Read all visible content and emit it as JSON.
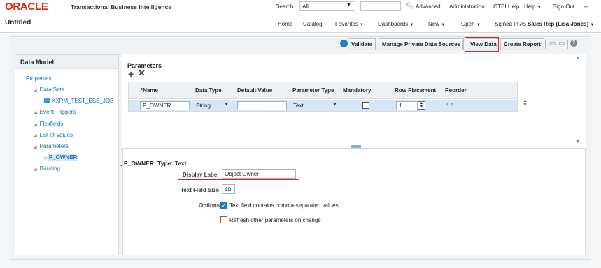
{
  "header": {
    "logo": "ORACLE",
    "product": "Transactional Business Intelligence",
    "search_label": "Search",
    "search_scope": "All",
    "advanced": "Advanced",
    "administration": "Administration",
    "otbi_help": "OTBI Help",
    "help": "Help",
    "sign_out": "Sign Out"
  },
  "subheader": {
    "title": "Untitled",
    "home": "Home",
    "catalog": "Catalog",
    "favorites": "Favorites",
    "dashboards": "Dashboards",
    "new": "New",
    "open": "Open",
    "signed_in_as": "Signed In As",
    "user": "Sales Rep (Lisa Jones)"
  },
  "toolbar": {
    "validate": "Validate",
    "manage_sources": "Manage Private Data Sources",
    "view_data": "View Data",
    "create_report": "Create Report"
  },
  "tree": {
    "header": "Data Model",
    "properties": "Properties",
    "data_sets": "Data Sets",
    "dataset_item": "XXRM_TEST_ESS_JOB",
    "event_triggers": "Event Triggers",
    "flexfields": "Flexfields",
    "list_of_values": "List of Values",
    "parameters": "Parameters",
    "param_item": "P_OWNER",
    "bursting": "Bursting"
  },
  "parameters": {
    "title": "Parameters",
    "columns": {
      "name": "*Name",
      "data_type": "Data Type",
      "default_value": "Default Value",
      "parameter_type": "Parameter Type",
      "mandatory": "Mandatory",
      "row_placement": "Row Placement",
      "reorder": "Reorder"
    },
    "row": {
      "name": "P_OWNER",
      "data_type": "String",
      "default_value": "",
      "parameter_type": "Text",
      "mandatory": false,
      "row_placement": "1"
    }
  },
  "detail": {
    "title": "P_OWNER: Type: Text",
    "display_label_label": "Display Label",
    "display_label_value": "Object Owner",
    "text_field_size_label": "Text Field Size",
    "text_field_size_value": "40",
    "options_label": "Options",
    "option1": "Text field contains comma-separated values",
    "option1_checked": true,
    "option2": "Refresh other parameters on change",
    "option2_checked": false
  },
  "colors": {
    "oracle_red": "#e2231a",
    "highlight_red": "#d9252a",
    "selection_blue": "#d4e6f7",
    "link_blue": "#1a6fb5"
  }
}
